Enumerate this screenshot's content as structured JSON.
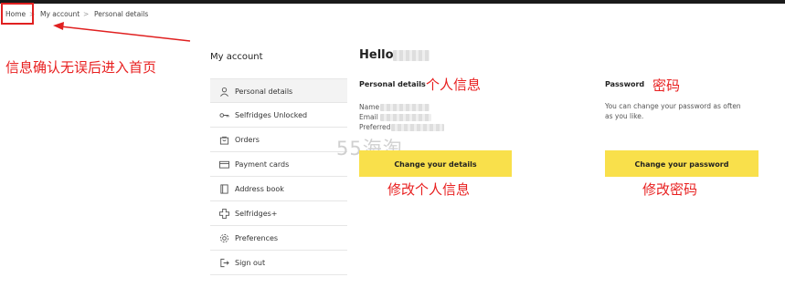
{
  "breadcrumb": {
    "home": "Home",
    "sep1": ">",
    "account": "My account",
    "sep2": ">",
    "current": "Personal details"
  },
  "annotations": {
    "left_note": "信息确认无误后进入首页",
    "personal_info": "个人信息",
    "password": "密码",
    "edit_personal": "修改个人信息",
    "edit_password": "修改密码"
  },
  "sidebar": {
    "title": "My account",
    "items": [
      {
        "label": "Personal details",
        "icon": "user-icon",
        "active": true
      },
      {
        "label": "Selfridges Unlocked",
        "icon": "key-icon"
      },
      {
        "label": "Orders",
        "icon": "bag-icon"
      },
      {
        "label": "Payment cards",
        "icon": "card-icon"
      },
      {
        "label": "Address book",
        "icon": "book-icon"
      },
      {
        "label": "Selfridges+",
        "icon": "plus-icon"
      },
      {
        "label": "Preferences",
        "icon": "gear-icon"
      },
      {
        "label": "Sign out",
        "icon": "signout-icon"
      }
    ]
  },
  "main": {
    "hello": "Hello",
    "personal_details_title": "Personal details",
    "name_label": "Name",
    "email_label": "Email",
    "pref_label": "Preferred",
    "change_details_button": "Change your details",
    "password_title": "Password",
    "password_text": "You can change your password as often as you like.",
    "change_password_button": "Change your password"
  },
  "watermark": "55海淘",
  "colors": {
    "accent_yellow": "#f9e04b",
    "annotation_red": "#e82020",
    "top_bar": "#1a1a1a"
  }
}
